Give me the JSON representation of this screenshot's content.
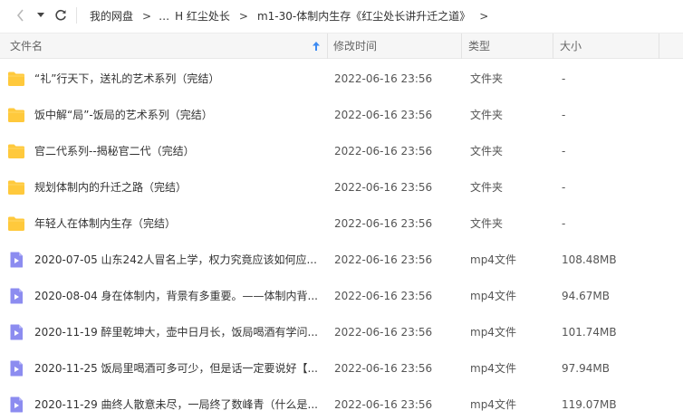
{
  "toolbar": {
    "back_icon": "chevron-left-icon",
    "dropdown_icon": "caret-down-icon",
    "refresh_icon": "refresh-icon"
  },
  "breadcrumb": {
    "items": [
      "我的网盘",
      "…",
      "H 红尘处长",
      "m1-30-体制内生存《红尘处长讲升迁之道》"
    ],
    "separator": ">"
  },
  "columns": {
    "name": "文件名",
    "time": "修改时间",
    "type": "类型",
    "size": "大小"
  },
  "sort": {
    "column": "name",
    "direction": "ascending",
    "icon": "sort-up-icon"
  },
  "colors": {
    "folder": "#FFC93C",
    "video": "#8C8CF0",
    "header_bg": "#F6F6F6",
    "sort_accent": "#3D8BF2"
  },
  "files": [
    {
      "icon": "folder-icon",
      "name": "“礼”行天下，送礼的艺术系列（完结）",
      "time": "2022-06-16 23:56",
      "type": "文件夹",
      "size": "-"
    },
    {
      "icon": "folder-icon",
      "name": "饭中解“局”-饭局的艺术系列（完结）",
      "time": "2022-06-16 23:56",
      "type": "文件夹",
      "size": "-"
    },
    {
      "icon": "folder-icon",
      "name": "官二代系列--揭秘官二代（完结）",
      "time": "2022-06-16 23:56",
      "type": "文件夹",
      "size": "-"
    },
    {
      "icon": "folder-icon",
      "name": "规划体制内的升迁之路（完结）",
      "time": "2022-06-16 23:56",
      "type": "文件夹",
      "size": "-"
    },
    {
      "icon": "folder-icon",
      "name": "年轻人在体制内生存（完结）",
      "time": "2022-06-16 23:56",
      "type": "文件夹",
      "size": "-"
    },
    {
      "icon": "video-file-icon",
      "name": "2020-07-05 山东242人冒名上学，权力究竟应该如何应...",
      "time": "2022-06-16 23:56",
      "type": "mp4文件",
      "size": "108.48MB"
    },
    {
      "icon": "video-file-icon",
      "name": "2020-08-04 身在体制内，背景有多重要。——体制内背...",
      "time": "2022-06-16 23:56",
      "type": "mp4文件",
      "size": "94.67MB"
    },
    {
      "icon": "video-file-icon",
      "name": "2020-11-19 醉里乾坤大，壶中日月长，饭局喝酒有学问...",
      "time": "2022-06-16 23:56",
      "type": "mp4文件",
      "size": "101.74MB"
    },
    {
      "icon": "video-file-icon",
      "name": "2020-11-25 饭局里喝酒可多可少，但是话一定要说好【...",
      "time": "2022-06-16 23:56",
      "type": "mp4文件",
      "size": "97.94MB"
    },
    {
      "icon": "video-file-icon",
      "name": "2020-11-29 曲终人散意未尽，一局终了数峰青（什么是...",
      "time": "2022-06-16 23:56",
      "type": "mp4文件",
      "size": "119.07MB"
    }
  ]
}
